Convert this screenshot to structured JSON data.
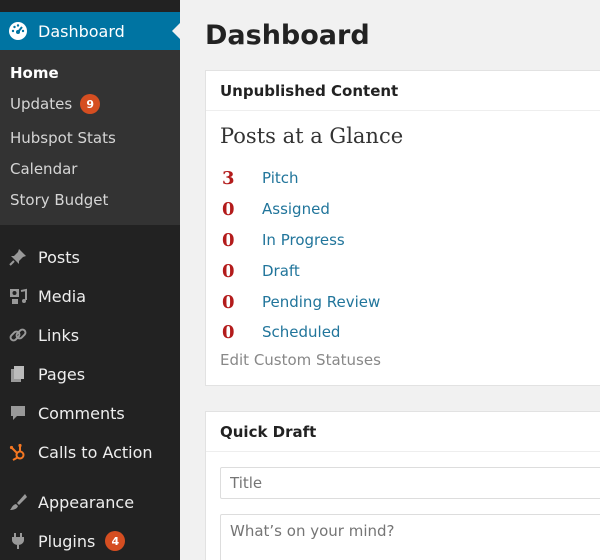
{
  "sidebar": {
    "dashboard_label": "Dashboard",
    "submenu": [
      {
        "label": "Home",
        "current": true
      },
      {
        "label": "Updates",
        "badge": "9"
      },
      {
        "label": "Hubspot Stats"
      },
      {
        "label": "Calendar"
      },
      {
        "label": "Story Budget"
      }
    ],
    "menu": [
      {
        "label": "Posts",
        "icon": "pushpin-icon"
      },
      {
        "label": "Media",
        "icon": "media-icon"
      },
      {
        "label": "Links",
        "icon": "link-icon"
      },
      {
        "label": "Pages",
        "icon": "pages-icon"
      },
      {
        "label": "Comments",
        "icon": "comment-icon"
      },
      {
        "label": "Calls to Action",
        "icon": "hubspot-icon"
      },
      {
        "label": "Appearance",
        "icon": "paintbrush-icon"
      },
      {
        "label": "Plugins",
        "icon": "plug-icon",
        "badge": "4"
      }
    ]
  },
  "main": {
    "title": "Dashboard",
    "unpublished_box": {
      "header": "Unpublished Content",
      "glance_title": "Posts at a Glance",
      "statuses": [
        {
          "count": "3",
          "name": "Pitch"
        },
        {
          "count": "0",
          "name": "Assigned"
        },
        {
          "count": "0",
          "name": "In Progress"
        },
        {
          "count": "0",
          "name": "Draft"
        },
        {
          "count": "0",
          "name": "Pending Review"
        },
        {
          "count": "0",
          "name": "Scheduled"
        }
      ],
      "edit_link": "Edit Custom Statuses"
    },
    "quick_draft": {
      "header": "Quick Draft",
      "title_placeholder": "Title",
      "content_placeholder": "What’s on your mind?"
    }
  },
  "colors": {
    "sidebar_bg": "#222222",
    "submenu_bg": "#333333",
    "accent": "#0074a2",
    "badge": "#d54e21",
    "count_red": "#b31b1b",
    "link_blue": "#21759b"
  }
}
